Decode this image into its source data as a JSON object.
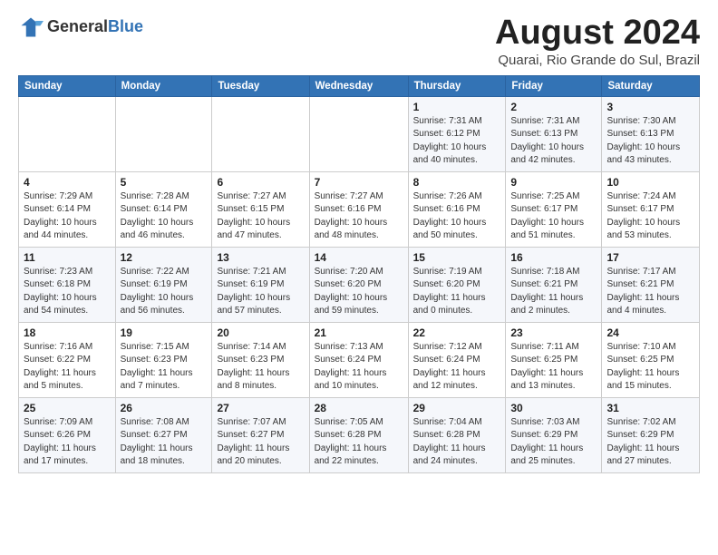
{
  "header": {
    "logo_general": "General",
    "logo_blue": "Blue",
    "month_title": "August 2024",
    "subtitle": "Quarai, Rio Grande do Sul, Brazil"
  },
  "weekdays": [
    "Sunday",
    "Monday",
    "Tuesday",
    "Wednesday",
    "Thursday",
    "Friday",
    "Saturday"
  ],
  "weeks": [
    [
      {
        "day": "",
        "info": ""
      },
      {
        "day": "",
        "info": ""
      },
      {
        "day": "",
        "info": ""
      },
      {
        "day": "",
        "info": ""
      },
      {
        "day": "1",
        "info": "Sunrise: 7:31 AM\nSunset: 6:12 PM\nDaylight: 10 hours\nand 40 minutes."
      },
      {
        "day": "2",
        "info": "Sunrise: 7:31 AM\nSunset: 6:13 PM\nDaylight: 10 hours\nand 42 minutes."
      },
      {
        "day": "3",
        "info": "Sunrise: 7:30 AM\nSunset: 6:13 PM\nDaylight: 10 hours\nand 43 minutes."
      }
    ],
    [
      {
        "day": "4",
        "info": "Sunrise: 7:29 AM\nSunset: 6:14 PM\nDaylight: 10 hours\nand 44 minutes."
      },
      {
        "day": "5",
        "info": "Sunrise: 7:28 AM\nSunset: 6:14 PM\nDaylight: 10 hours\nand 46 minutes."
      },
      {
        "day": "6",
        "info": "Sunrise: 7:27 AM\nSunset: 6:15 PM\nDaylight: 10 hours\nand 47 minutes."
      },
      {
        "day": "7",
        "info": "Sunrise: 7:27 AM\nSunset: 6:16 PM\nDaylight: 10 hours\nand 48 minutes."
      },
      {
        "day": "8",
        "info": "Sunrise: 7:26 AM\nSunset: 6:16 PM\nDaylight: 10 hours\nand 50 minutes."
      },
      {
        "day": "9",
        "info": "Sunrise: 7:25 AM\nSunset: 6:17 PM\nDaylight: 10 hours\nand 51 minutes."
      },
      {
        "day": "10",
        "info": "Sunrise: 7:24 AM\nSunset: 6:17 PM\nDaylight: 10 hours\nand 53 minutes."
      }
    ],
    [
      {
        "day": "11",
        "info": "Sunrise: 7:23 AM\nSunset: 6:18 PM\nDaylight: 10 hours\nand 54 minutes."
      },
      {
        "day": "12",
        "info": "Sunrise: 7:22 AM\nSunset: 6:19 PM\nDaylight: 10 hours\nand 56 minutes."
      },
      {
        "day": "13",
        "info": "Sunrise: 7:21 AM\nSunset: 6:19 PM\nDaylight: 10 hours\nand 57 minutes."
      },
      {
        "day": "14",
        "info": "Sunrise: 7:20 AM\nSunset: 6:20 PM\nDaylight: 10 hours\nand 59 minutes."
      },
      {
        "day": "15",
        "info": "Sunrise: 7:19 AM\nSunset: 6:20 PM\nDaylight: 11 hours\nand 0 minutes."
      },
      {
        "day": "16",
        "info": "Sunrise: 7:18 AM\nSunset: 6:21 PM\nDaylight: 11 hours\nand 2 minutes."
      },
      {
        "day": "17",
        "info": "Sunrise: 7:17 AM\nSunset: 6:21 PM\nDaylight: 11 hours\nand 4 minutes."
      }
    ],
    [
      {
        "day": "18",
        "info": "Sunrise: 7:16 AM\nSunset: 6:22 PM\nDaylight: 11 hours\nand 5 minutes."
      },
      {
        "day": "19",
        "info": "Sunrise: 7:15 AM\nSunset: 6:23 PM\nDaylight: 11 hours\nand 7 minutes."
      },
      {
        "day": "20",
        "info": "Sunrise: 7:14 AM\nSunset: 6:23 PM\nDaylight: 11 hours\nand 8 minutes."
      },
      {
        "day": "21",
        "info": "Sunrise: 7:13 AM\nSunset: 6:24 PM\nDaylight: 11 hours\nand 10 minutes."
      },
      {
        "day": "22",
        "info": "Sunrise: 7:12 AM\nSunset: 6:24 PM\nDaylight: 11 hours\nand 12 minutes."
      },
      {
        "day": "23",
        "info": "Sunrise: 7:11 AM\nSunset: 6:25 PM\nDaylight: 11 hours\nand 13 minutes."
      },
      {
        "day": "24",
        "info": "Sunrise: 7:10 AM\nSunset: 6:25 PM\nDaylight: 11 hours\nand 15 minutes."
      }
    ],
    [
      {
        "day": "25",
        "info": "Sunrise: 7:09 AM\nSunset: 6:26 PM\nDaylight: 11 hours\nand 17 minutes."
      },
      {
        "day": "26",
        "info": "Sunrise: 7:08 AM\nSunset: 6:27 PM\nDaylight: 11 hours\nand 18 minutes."
      },
      {
        "day": "27",
        "info": "Sunrise: 7:07 AM\nSunset: 6:27 PM\nDaylight: 11 hours\nand 20 minutes."
      },
      {
        "day": "28",
        "info": "Sunrise: 7:05 AM\nSunset: 6:28 PM\nDaylight: 11 hours\nand 22 minutes."
      },
      {
        "day": "29",
        "info": "Sunrise: 7:04 AM\nSunset: 6:28 PM\nDaylight: 11 hours\nand 24 minutes."
      },
      {
        "day": "30",
        "info": "Sunrise: 7:03 AM\nSunset: 6:29 PM\nDaylight: 11 hours\nand 25 minutes."
      },
      {
        "day": "31",
        "info": "Sunrise: 7:02 AM\nSunset: 6:29 PM\nDaylight: 11 hours\nand 27 minutes."
      }
    ]
  ]
}
